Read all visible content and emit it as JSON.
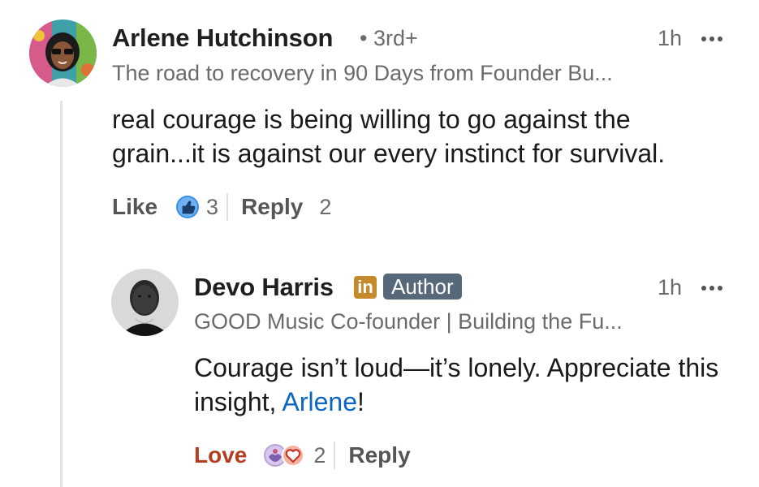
{
  "comment": {
    "author": "Arlene Hutchinson",
    "degree": "• 3rd+",
    "time": "1h",
    "headline": "The road to recovery in 90 Days from Founder Bu...",
    "text": "real courage is being willing to go against the grain...it is against our every instinct for survival.",
    "like_label": "Like",
    "reaction_count": "3",
    "reply_label": "Reply",
    "reply_count": "2",
    "reaction_icon": "like-thumb-icon"
  },
  "reply": {
    "author": "Devo Harris",
    "linkedin_badge": "in",
    "author_badge": "Author",
    "time": "1h",
    "headline": "GOOD Music Co-founder | Building the Fu...",
    "text_before": "Courage isn’t loud—it’s lonely. Appreciate this insight, ",
    "mention": "Arlene",
    "text_after": "!",
    "love_label": "Love",
    "reaction_count": "2",
    "reply_label": "Reply",
    "reaction_icons": [
      "support-icon",
      "love-heart-icon"
    ]
  },
  "colors": {
    "like_blue": "#378fe9",
    "love_red": "#b24020",
    "mention_blue": "#0a66c2",
    "author_badge_bg": "#56687a",
    "linkedin_badge_bg": "#c58a2b"
  }
}
